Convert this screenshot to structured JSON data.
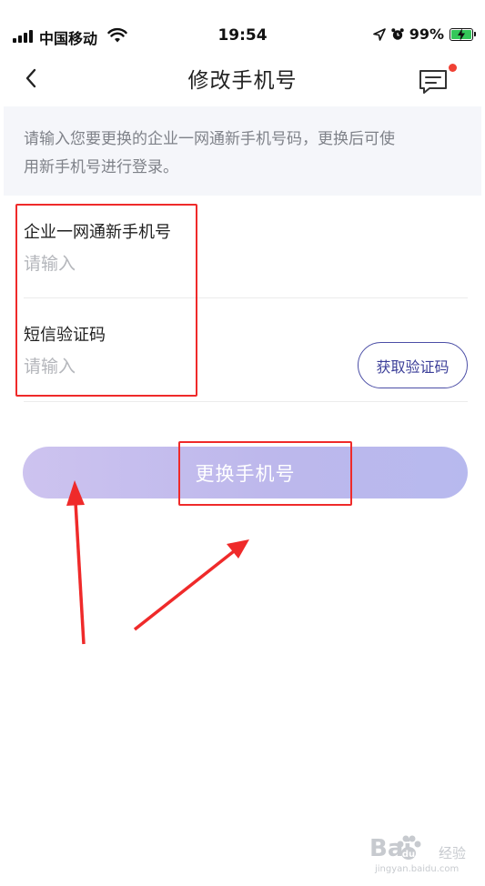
{
  "status_bar": {
    "carrier": "中国移动",
    "time": "19:54",
    "battery_percent": "99%",
    "icons": [
      "signal-icon",
      "wifi-icon",
      "location-icon",
      "alarm-icon",
      "battery-charging-icon"
    ]
  },
  "nav": {
    "title": "修改手机号",
    "back_icon": "chevron-left-icon",
    "message_icon": "message-icon",
    "has_unread_badge": true,
    "badge_color": "#f04134"
  },
  "info": {
    "line1": "请输入您要更换的企业一网通新手机号码，更换后可使",
    "line2": "用新手机号进行登录。"
  },
  "form": {
    "phone": {
      "label": "企业一网通新手机号",
      "placeholder": "请输入",
      "value": ""
    },
    "sms_code": {
      "label": "短信验证码",
      "placeholder": "请输入",
      "value": "",
      "send_button": "获取验证码"
    },
    "submit_label": "更换手机号",
    "submit_enabled": false
  },
  "colors": {
    "accent": "#3c3f99",
    "submit_gradient_start": "#cdc3ef",
    "submit_gradient_end": "#b7b9ee",
    "annotation": "#ef2a2a"
  },
  "watermark": {
    "brand": "Bai",
    "brand_suffix": "经验",
    "url": "jingyan.baidu.com"
  }
}
